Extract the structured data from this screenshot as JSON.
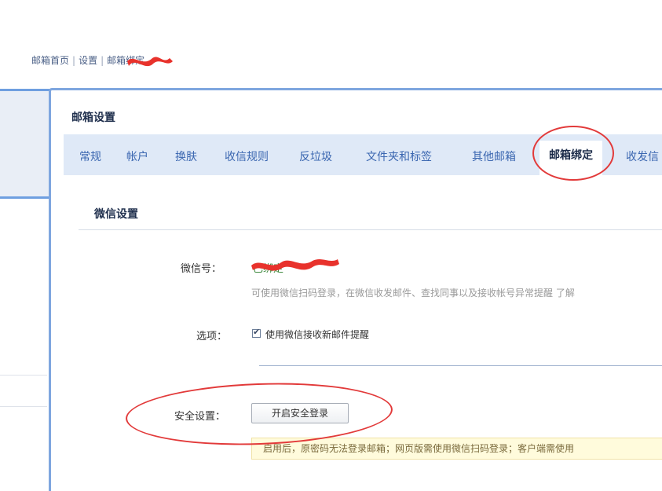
{
  "breadcrumb": {
    "home": "邮箱首页",
    "sep": "|",
    "settings": "设置",
    "current": "邮箱绑定"
  },
  "panel": {
    "title": "邮箱设置"
  },
  "tabs": [
    {
      "label": "常规"
    },
    {
      "label": "帐户"
    },
    {
      "label": "换肤"
    },
    {
      "label": "收信规则"
    },
    {
      "label": "反垃圾"
    },
    {
      "label": "文件夹和标签"
    },
    {
      "label": "其他邮箱"
    },
    {
      "label": "邮箱绑定",
      "active": true
    },
    {
      "label": "收发信"
    }
  ],
  "wechat": {
    "section_title": "微信设置",
    "account_label": "微信号：",
    "account_value": "已绑定",
    "account_desc": "可使用微信扫码登录，在微信收发邮件、查找同事以及接收帐号异常提醒 了解",
    "options_label": "选项：",
    "option_text": "使用微信接收新邮件提醒",
    "option_checked": true,
    "security_label": "安全设置：",
    "security_button": "开启安全登录",
    "security_notice": "启用后，原密码无法登录邮箱；网页版需使用微信扫码登录；客户端需使用"
  },
  "colors": {
    "accent": "#7ea6df",
    "tab_text": "#3a66b0",
    "annotation": "#e23a3a"
  }
}
